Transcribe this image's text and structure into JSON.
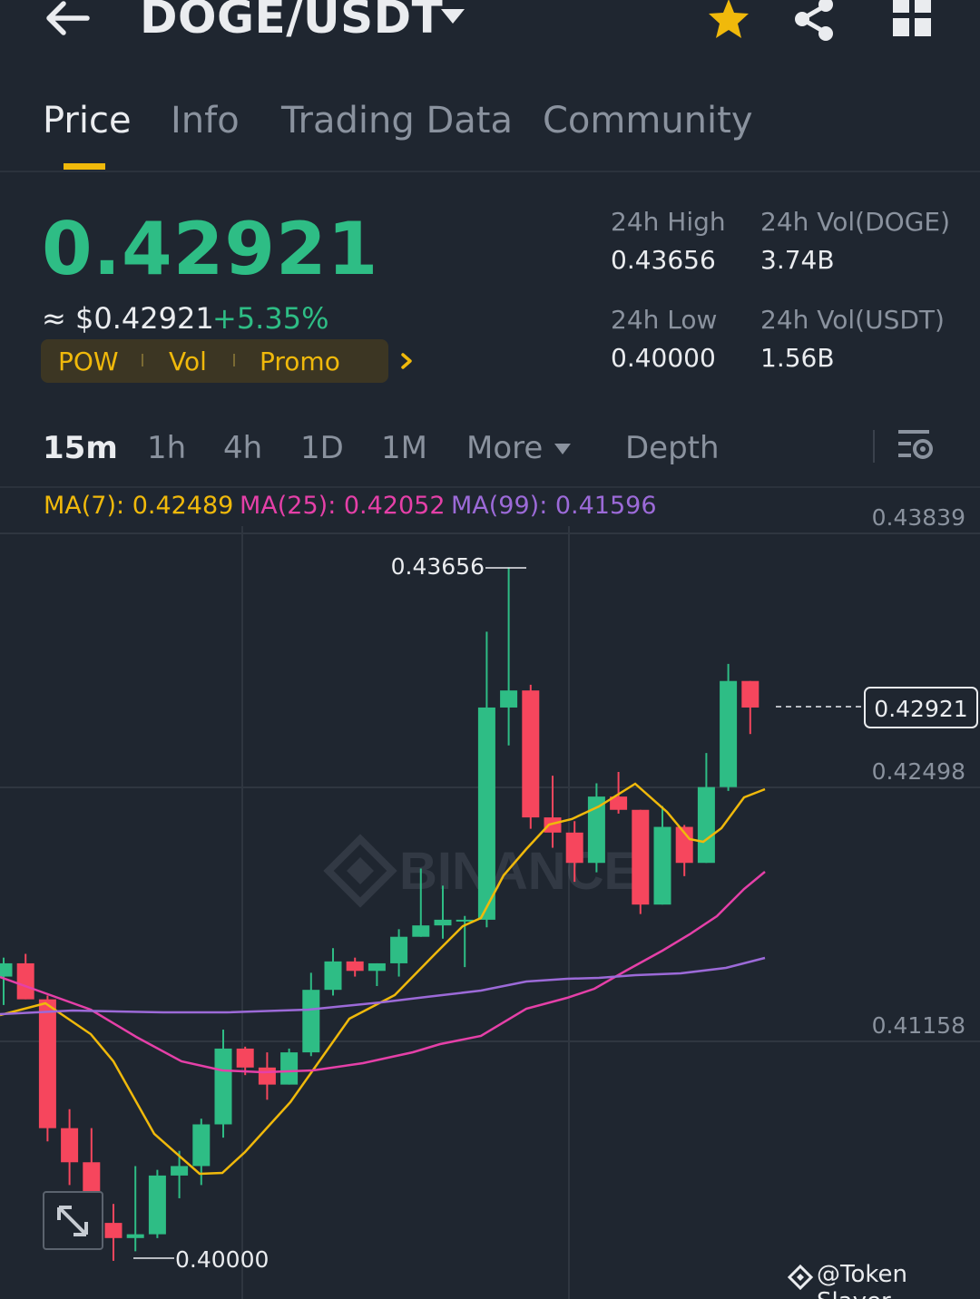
{
  "header": {
    "pair": "DOGE/USDT",
    "icons": [
      "back-arrow-icon",
      "caret-down-icon",
      "star-icon",
      "share-icon",
      "grid-icon"
    ],
    "star_color": "#f0b90b"
  },
  "tabs": [
    {
      "label": "Price",
      "active": true
    },
    {
      "label": "Info",
      "active": false
    },
    {
      "label": "Trading Data",
      "active": false
    },
    {
      "label": "Community",
      "active": false
    }
  ],
  "price": {
    "last": "0.42921",
    "usd": "≈ $0.42921",
    "change": "+5.35%",
    "color_up": "#2ebd85",
    "color_down": "#f6465d"
  },
  "tags": {
    "pow": "POW",
    "vol": "Vol",
    "promo": "Promo"
  },
  "stats": {
    "high_label": "24h High",
    "high_value": "0.43656",
    "low_label": "24h Low",
    "low_value": "0.40000",
    "vol_doge_label": "24h Vol(DOGE)",
    "vol_doge_value": "3.74B",
    "vol_usdt_label": "24h Vol(USDT)",
    "vol_usdt_value": "1.56B"
  },
  "intervals": {
    "items": [
      "15m",
      "1h",
      "4h",
      "1D",
      "1M"
    ],
    "active": "15m",
    "more": "More",
    "depth": "Depth"
  },
  "ma": {
    "ma7": "MA(7): 0.42489",
    "ma7_color": "#f0b90b",
    "ma25": "MA(25): 0.42052",
    "ma25_color": "#e540a8",
    "ma99": "MA(99): 0.41596",
    "ma99_color": "#9c6ad8"
  },
  "chart_data": {
    "type": "candlestick",
    "y_ticks": [
      "0.43839",
      "0.42498",
      "0.41158"
    ],
    "ylim": [
      0.3979,
      0.4384
    ],
    "high_marker": "0.43656",
    "low_marker": "0.40000",
    "current_price_label": "0.42921",
    "watermark": "BINANCE",
    "candles": [
      {
        "o": 0.415,
        "h": 0.416,
        "l": 0.4135,
        "c": 0.4157
      },
      {
        "o": 0.4157,
        "h": 0.4162,
        "l": 0.4138,
        "c": 0.4138
      },
      {
        "o": 0.4138,
        "h": 0.414,
        "l": 0.4063,
        "c": 0.407
      },
      {
        "o": 0.407,
        "h": 0.408,
        "l": 0.404,
        "c": 0.4052
      },
      {
        "o": 0.4052,
        "h": 0.407,
        "l": 0.4015,
        "c": 0.402
      },
      {
        "o": 0.402,
        "h": 0.403,
        "l": 0.4,
        "c": 0.4012
      },
      {
        "o": 0.4012,
        "h": 0.405,
        "l": 0.4005,
        "c": 0.4014
      },
      {
        "o": 0.4014,
        "h": 0.4048,
        "l": 0.4012,
        "c": 0.4045
      },
      {
        "o": 0.4045,
        "h": 0.4058,
        "l": 0.4033,
        "c": 0.405
      },
      {
        "o": 0.405,
        "h": 0.4075,
        "l": 0.404,
        "c": 0.4072
      },
      {
        "o": 0.4072,
        "h": 0.4122,
        "l": 0.4065,
        "c": 0.4112
      },
      {
        "o": 0.4112,
        "h": 0.4113,
        "l": 0.4098,
        "c": 0.4102
      },
      {
        "o": 0.4102,
        "h": 0.411,
        "l": 0.4085,
        "c": 0.4093
      },
      {
        "o": 0.4093,
        "h": 0.4112,
        "l": 0.4093,
        "c": 0.411
      },
      {
        "o": 0.411,
        "h": 0.4152,
        "l": 0.4108,
        "c": 0.4143
      },
      {
        "o": 0.4143,
        "h": 0.4165,
        "l": 0.414,
        "c": 0.4158
      },
      {
        "o": 0.4158,
        "h": 0.416,
        "l": 0.415,
        "c": 0.4153
      },
      {
        "o": 0.4153,
        "h": 0.4157,
        "l": 0.4145,
        "c": 0.4157
      },
      {
        "o": 0.4157,
        "h": 0.4175,
        "l": 0.415,
        "c": 0.4171
      },
      {
        "o": 0.4171,
        "h": 0.4207,
        "l": 0.4171,
        "c": 0.4177
      },
      {
        "o": 0.4177,
        "h": 0.4198,
        "l": 0.417,
        "c": 0.418
      },
      {
        "o": 0.418,
        "h": 0.4182,
        "l": 0.4155,
        "c": 0.418
      },
      {
        "o": 0.418,
        "h": 0.4332,
        "l": 0.4176,
        "c": 0.4292
      },
      {
        "o": 0.4292,
        "h": 0.4366,
        "l": 0.4272,
        "c": 0.4301
      },
      {
        "o": 0.4301,
        "h": 0.4304,
        "l": 0.4228,
        "c": 0.4234
      },
      {
        "o": 0.4234,
        "h": 0.4256,
        "l": 0.4218,
        "c": 0.4226
      },
      {
        "o": 0.4226,
        "h": 0.4232,
        "l": 0.42,
        "c": 0.421
      },
      {
        "o": 0.421,
        "h": 0.4252,
        "l": 0.4205,
        "c": 0.4245
      },
      {
        "o": 0.4245,
        "h": 0.4258,
        "l": 0.4236,
        "c": 0.4238
      },
      {
        "o": 0.4238,
        "h": 0.4238,
        "l": 0.4183,
        "c": 0.4188
      },
      {
        "o": 0.4188,
        "h": 0.424,
        "l": 0.4188,
        "c": 0.4229
      },
      {
        "o": 0.4229,
        "h": 0.423,
        "l": 0.4203,
        "c": 0.421
      },
      {
        "o": 0.421,
        "h": 0.4268,
        "l": 0.421,
        "c": 0.425
      },
      {
        "o": 0.425,
        "h": 0.4315,
        "l": 0.4248,
        "c": 0.4306
      },
      {
        "o": 0.4306,
        "h": 0.4306,
        "l": 0.4278,
        "c": 0.4292
      }
    ]
  },
  "credit": {
    "handle": "@Token Slayer"
  }
}
